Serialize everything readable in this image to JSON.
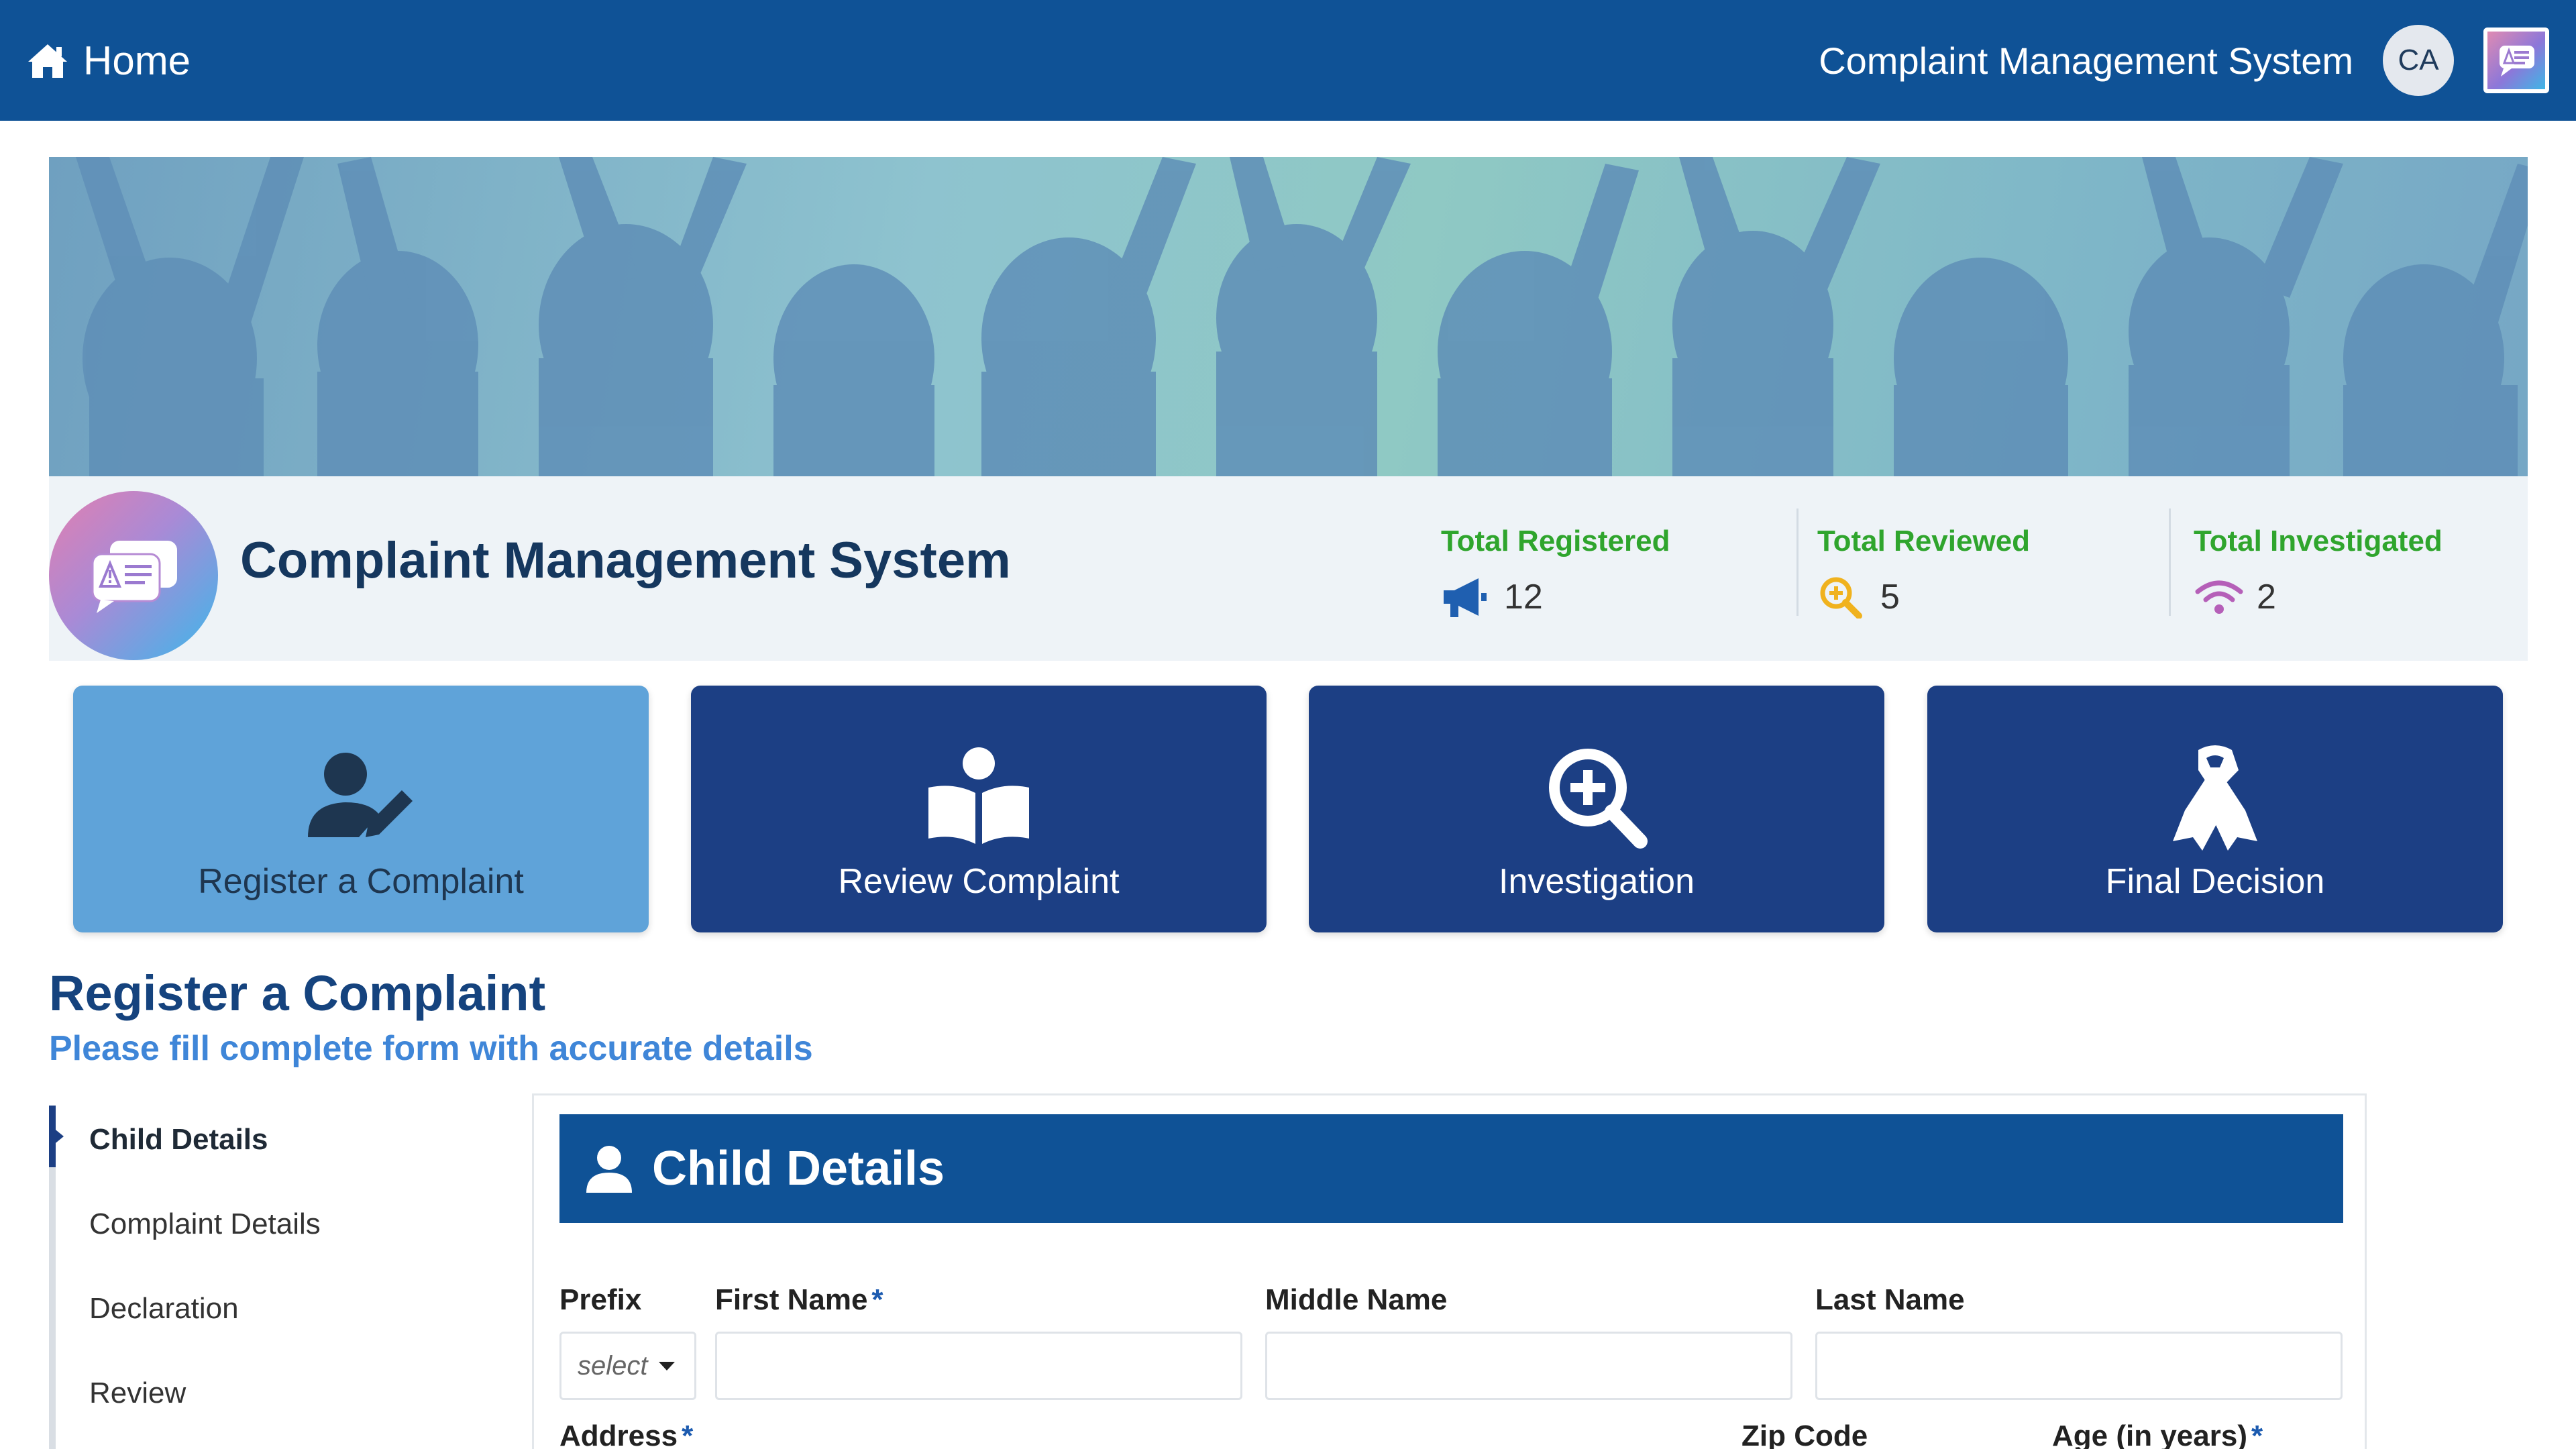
{
  "topbar": {
    "home_label": "Home",
    "app_title": "Complaint Management System",
    "avatar_initials": "CA",
    "bg_color": "#0f5296"
  },
  "info": {
    "title": "Complaint Management System",
    "stats": [
      {
        "label": "Total Registered",
        "value": "12",
        "icon": "megaphone-icon"
      },
      {
        "label": "Total Reviewed",
        "value": "5",
        "icon": "magnify-plus-icon"
      },
      {
        "label": "Total Investigated",
        "value": "2",
        "icon": "wifi-signal-icon"
      }
    ]
  },
  "cards": [
    {
      "label": "Register a Complaint",
      "icon": "user-edit-icon",
      "active": true
    },
    {
      "label": "Review Complaint",
      "icon": "reader-book-icon",
      "active": false
    },
    {
      "label": "Investigation",
      "icon": "search-plus-icon",
      "active": false
    },
    {
      "label": "Final Decision",
      "icon": "ribbon-icon",
      "active": false
    }
  ],
  "section": {
    "title": "Register a Complaint",
    "subtitle": "Please fill complete form with accurate details"
  },
  "steps": [
    {
      "label": "Child Details",
      "active": true
    },
    {
      "label": "Complaint Details",
      "active": false
    },
    {
      "label": "Declaration",
      "active": false
    },
    {
      "label": "Review",
      "active": false
    }
  ],
  "form": {
    "header": "Child Details",
    "fields": {
      "prefix": {
        "label": "Prefix",
        "placeholder": "select"
      },
      "first_name": {
        "label": "First Name",
        "required": "*",
        "value": ""
      },
      "middle_name": {
        "label": "Middle Name",
        "value": ""
      },
      "last_name": {
        "label": "Last Name",
        "value": ""
      },
      "address": {
        "label": "Address",
        "required": "*"
      },
      "zip_code": {
        "label": "Zip Code"
      },
      "age": {
        "label": "Age (in years)",
        "required": "*"
      }
    }
  },
  "colors": {
    "primary": "#0f5296",
    "card_dark": "#1c3f84",
    "card_active": "#5fa3d9",
    "stat_label": "#2fa52d",
    "subtitle": "#3f86d8"
  }
}
